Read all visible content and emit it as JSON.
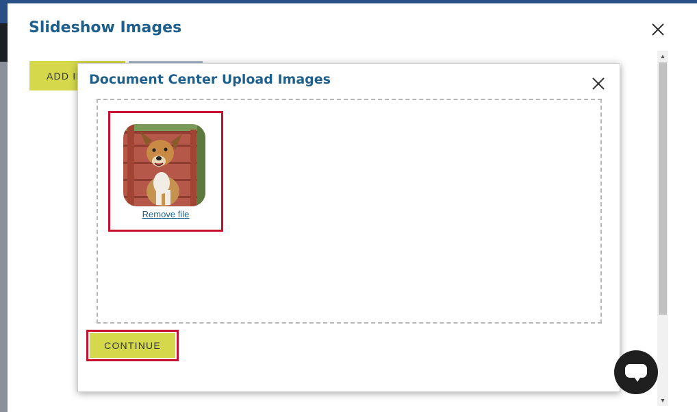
{
  "outer_modal": {
    "title": "Slideshow Images",
    "add_button_label": "ADD IMAGES"
  },
  "inner_modal": {
    "title": "Document Center Upload Images",
    "remove_file_label": "Remove file",
    "continue_label": "CONTINUE"
  },
  "colors": {
    "title_blue": "#1f5f8b",
    "button_yellow": "#d4d84a",
    "highlight_red": "#c8102e"
  },
  "icons": {
    "close": "close-icon",
    "chat": "chat-icon"
  }
}
